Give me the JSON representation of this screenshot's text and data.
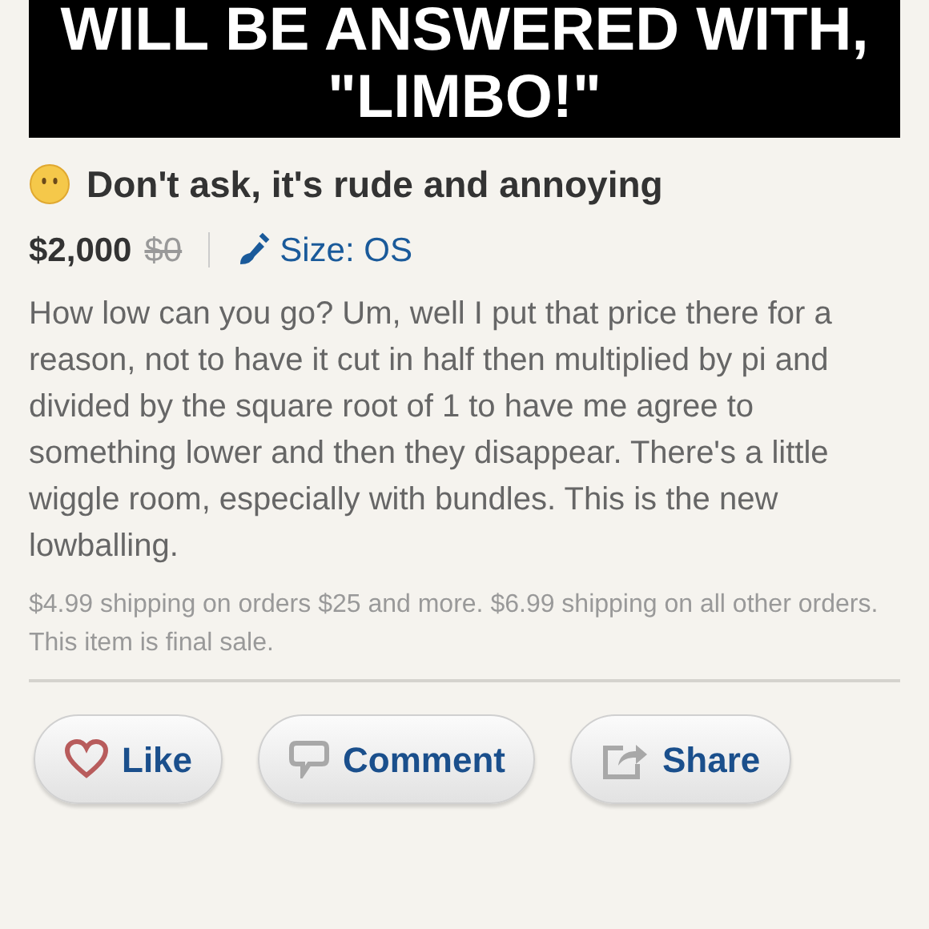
{
  "banner": {
    "lines": [
      "WILL BE ANSWERED WITH,",
      "\"LIMBO!\""
    ]
  },
  "listing": {
    "title": "Don't ask, it's rude and annoying",
    "price": "$2,000",
    "original_price": "$0",
    "size": "Size: OS",
    "description": "How low can you go? Um, well I put that price there for a reason, not to have it cut in half then multiplied by pi and divided by the square root of 1 to have me agree to something lower and then they disappear. There's a little wiggle room, especially with bundles. This is the new lowballing.",
    "shipping": "$4.99 shipping on orders $25 and more. $6.99 shipping on all other orders. This item is final sale."
  },
  "actions": [
    {
      "kind": "like",
      "label": "Like"
    },
    {
      "kind": "comment",
      "label": "Comment"
    },
    {
      "kind": "share",
      "label": "Share"
    }
  ]
}
